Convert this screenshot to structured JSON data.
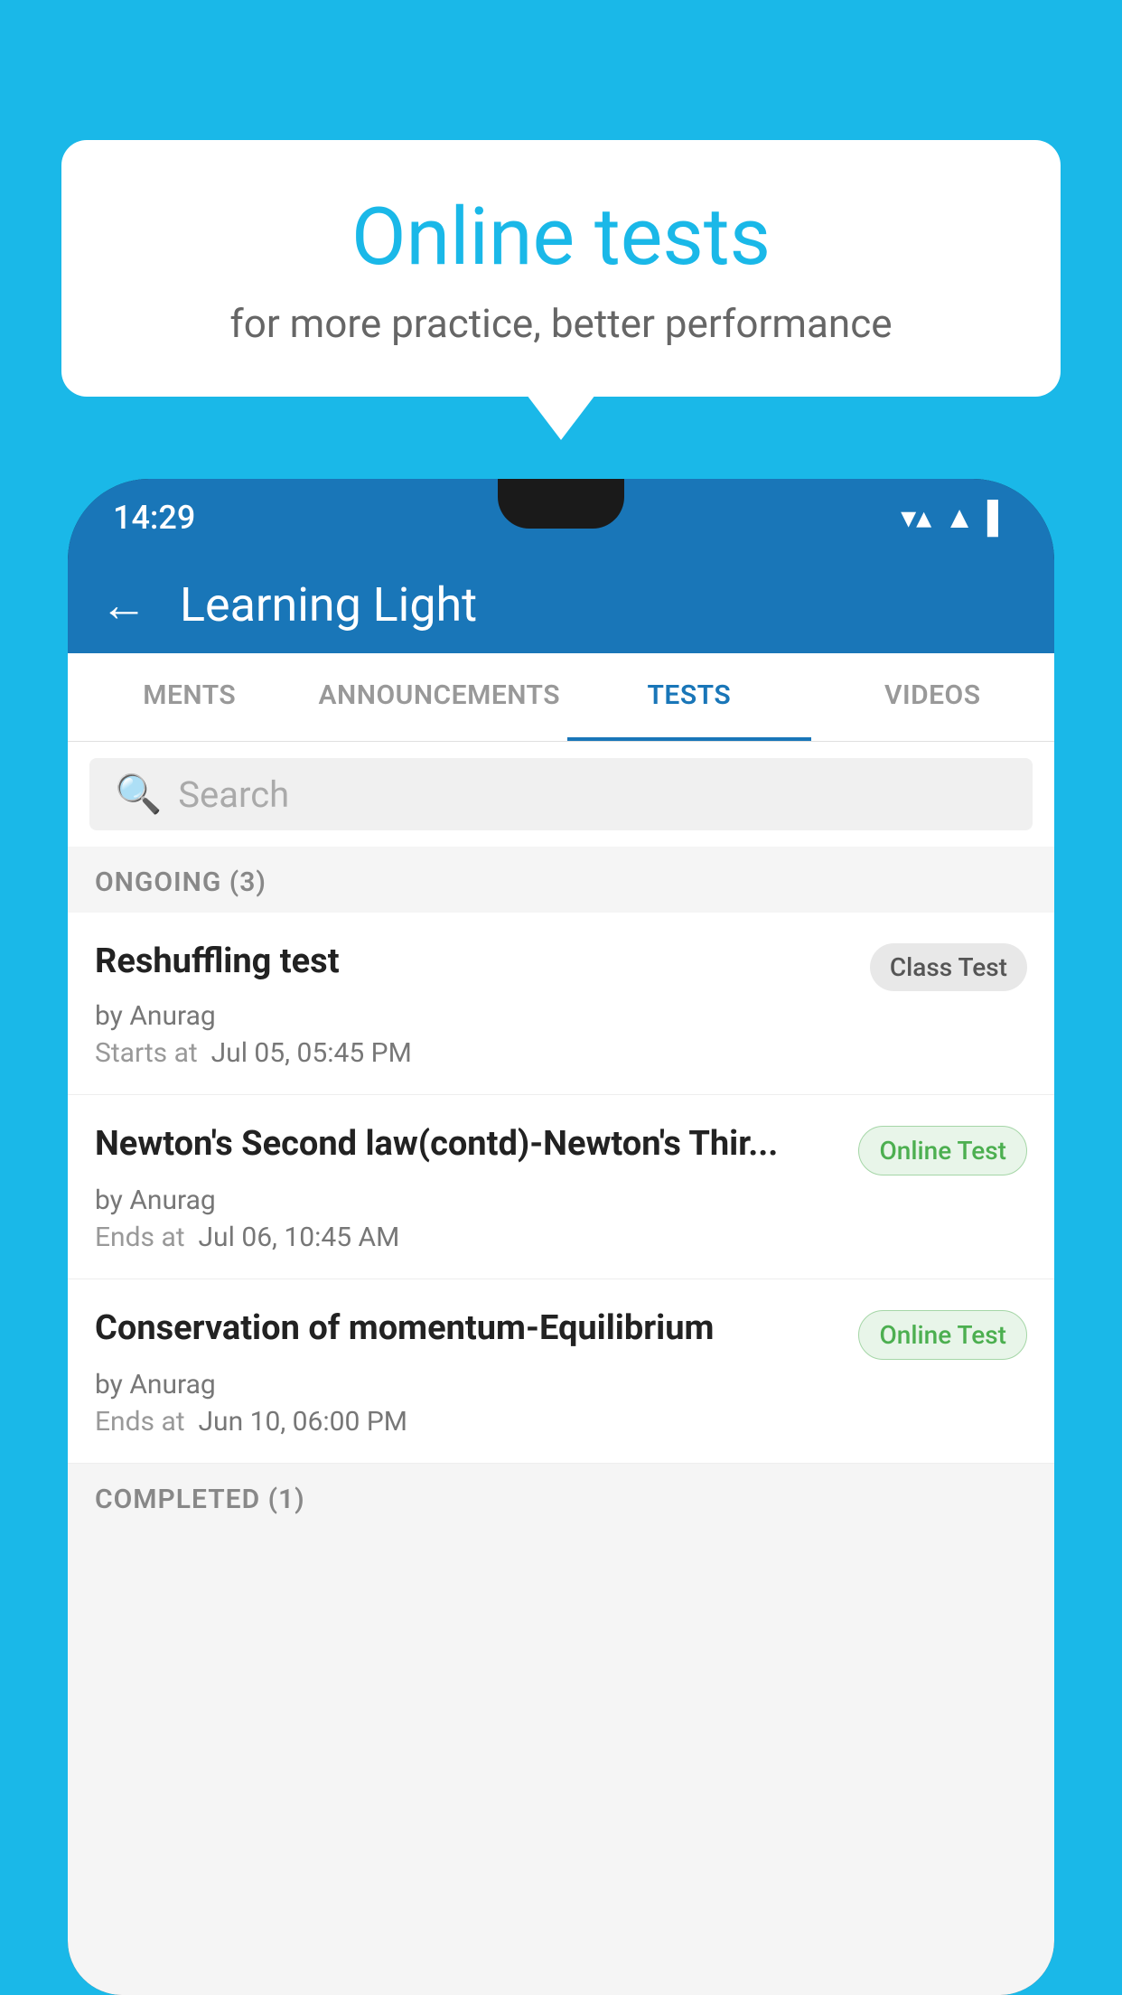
{
  "background": {
    "color": "#1ab8e8"
  },
  "speech_bubble": {
    "title": "Online tests",
    "subtitle": "for more practice, better performance"
  },
  "phone": {
    "status_bar": {
      "time": "14:29",
      "icons": [
        "▼",
        "▲",
        "▌"
      ]
    },
    "app_header": {
      "back_label": "←",
      "title": "Learning Light"
    },
    "tabs": [
      {
        "label": "MENTS",
        "active": false
      },
      {
        "label": "ANNOUNCEMENTS",
        "active": false
      },
      {
        "label": "TESTS",
        "active": true
      },
      {
        "label": "VIDEOS",
        "active": false
      }
    ],
    "search": {
      "placeholder": "Search"
    },
    "sections": [
      {
        "label": "ONGOING (3)",
        "items": [
          {
            "name": "Reshuffling test",
            "badge": "Class Test",
            "badge_type": "class",
            "author": "by Anurag",
            "date_label": "Starts at",
            "date": "Jul 05, 05:45 PM"
          },
          {
            "name": "Newton's Second law(contd)-Newton's Thir...",
            "badge": "Online Test",
            "badge_type": "online",
            "author": "by Anurag",
            "date_label": "Ends at",
            "date": "Jul 06, 10:45 AM"
          },
          {
            "name": "Conservation of momentum-Equilibrium",
            "badge": "Online Test",
            "badge_type": "online",
            "author": "by Anurag",
            "date_label": "Ends at",
            "date": "Jun 10, 06:00 PM"
          }
        ]
      }
    ],
    "completed_section_label": "COMPLETED (1)"
  }
}
